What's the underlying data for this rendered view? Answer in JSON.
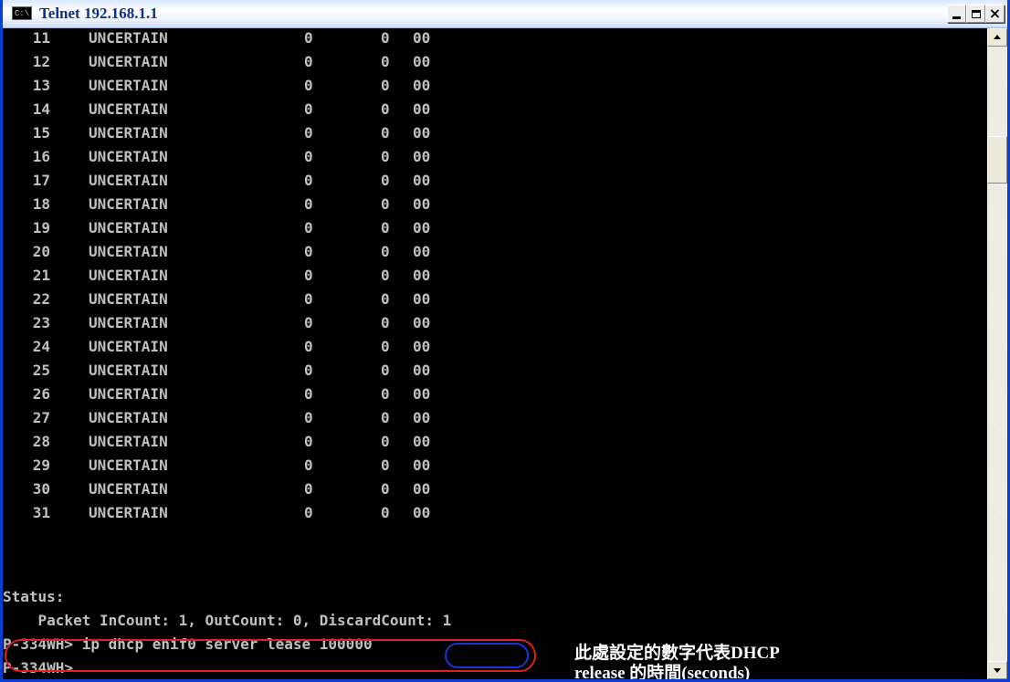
{
  "window": {
    "title": "Telnet 192.168.1.1",
    "icon": "console-icon",
    "icon_text": "C:\\"
  },
  "controls": {
    "minimize": "minimize-icon",
    "maximize": "maximize-icon",
    "close": "close-icon",
    "close_glyph": "×"
  },
  "table_rows": [
    {
      "num": "11",
      "state": "UNCERTAIN",
      "a": "0",
      "b": "0",
      "c": "00"
    },
    {
      "num": "12",
      "state": "UNCERTAIN",
      "a": "0",
      "b": "0",
      "c": "00"
    },
    {
      "num": "13",
      "state": "UNCERTAIN",
      "a": "0",
      "b": "0",
      "c": "00"
    },
    {
      "num": "14",
      "state": "UNCERTAIN",
      "a": "0",
      "b": "0",
      "c": "00"
    },
    {
      "num": "15",
      "state": "UNCERTAIN",
      "a": "0",
      "b": "0",
      "c": "00"
    },
    {
      "num": "16",
      "state": "UNCERTAIN",
      "a": "0",
      "b": "0",
      "c": "00"
    },
    {
      "num": "17",
      "state": "UNCERTAIN",
      "a": "0",
      "b": "0",
      "c": "00"
    },
    {
      "num": "18",
      "state": "UNCERTAIN",
      "a": "0",
      "b": "0",
      "c": "00"
    },
    {
      "num": "19",
      "state": "UNCERTAIN",
      "a": "0",
      "b": "0",
      "c": "00"
    },
    {
      "num": "20",
      "state": "UNCERTAIN",
      "a": "0",
      "b": "0",
      "c": "00"
    },
    {
      "num": "21",
      "state": "UNCERTAIN",
      "a": "0",
      "b": "0",
      "c": "00"
    },
    {
      "num": "22",
      "state": "UNCERTAIN",
      "a": "0",
      "b": "0",
      "c": "00"
    },
    {
      "num": "23",
      "state": "UNCERTAIN",
      "a": "0",
      "b": "0",
      "c": "00"
    },
    {
      "num": "24",
      "state": "UNCERTAIN",
      "a": "0",
      "b": "0",
      "c": "00"
    },
    {
      "num": "25",
      "state": "UNCERTAIN",
      "a": "0",
      "b": "0",
      "c": "00"
    },
    {
      "num": "26",
      "state": "UNCERTAIN",
      "a": "0",
      "b": "0",
      "c": "00"
    },
    {
      "num": "27",
      "state": "UNCERTAIN",
      "a": "0",
      "b": "0",
      "c": "00"
    },
    {
      "num": "28",
      "state": "UNCERTAIN",
      "a": "0",
      "b": "0",
      "c": "00"
    },
    {
      "num": "29",
      "state": "UNCERTAIN",
      "a": "0",
      "b": "0",
      "c": "00"
    },
    {
      "num": "30",
      "state": "UNCERTAIN",
      "a": "0",
      "b": "0",
      "c": "00"
    },
    {
      "num": "31",
      "state": "UNCERTAIN",
      "a": "0",
      "b": "0",
      "c": "00"
    }
  ],
  "status": {
    "label": "Status:",
    "packet_line": "    Packet InCount: 1, OutCount: 0, DiscardCount: 1"
  },
  "command": {
    "prompt_line": "P-334WH> ip dhcp enif0 server lease 100000",
    "prompt_only": "P-334WH>"
  },
  "annotation": {
    "line1": "此處設定的數字代表DHCP",
    "line2": "release 的時間(seconds)"
  },
  "colors": {
    "console_bg": "#000000",
    "console_text": "#c0c0c0",
    "title_bar": "#d8e8ff",
    "window_border": "#0a3fd2",
    "highlight_command": "#e02020",
    "highlight_value": "#1b34d8",
    "annotation_text": "#ffffff"
  },
  "scrollbar": {
    "up_icon": "arrow-up-icon",
    "down_icon": "arrow-down-icon"
  }
}
